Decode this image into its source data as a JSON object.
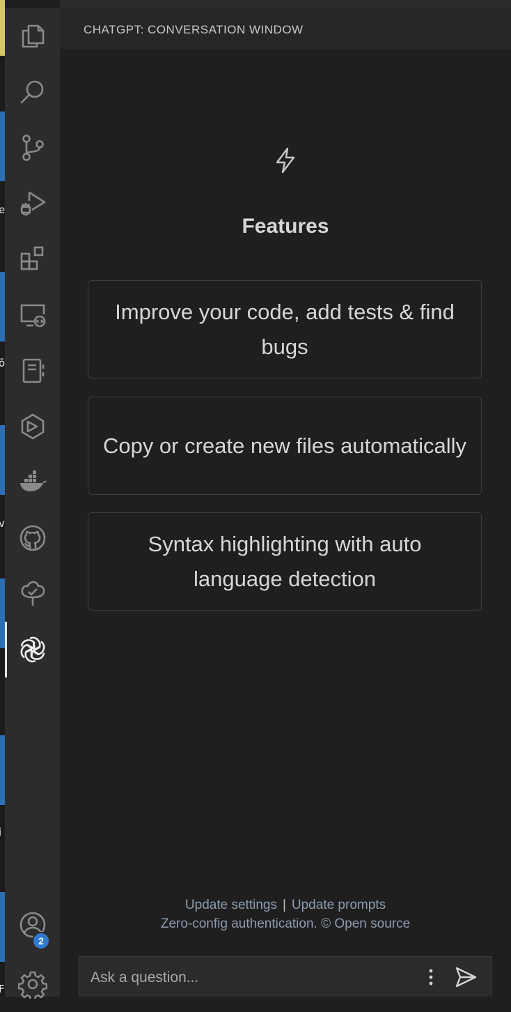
{
  "header": {
    "title": "CHATGPT: CONVERSATION WINDOW"
  },
  "activity_bar": {
    "items": [
      {
        "icon": "files-icon"
      },
      {
        "icon": "search-icon"
      },
      {
        "icon": "source-control-icon"
      },
      {
        "icon": "run-debug-icon"
      },
      {
        "icon": "extensions-icon"
      },
      {
        "icon": "remote-explorer-icon"
      },
      {
        "icon": "notebook-icon"
      },
      {
        "icon": "cube-icon"
      },
      {
        "icon": "docker-icon"
      },
      {
        "icon": "github-icon"
      },
      {
        "icon": "tree-check-icon"
      },
      {
        "icon": "openai-icon",
        "active": true
      }
    ],
    "accounts_badge": "2",
    "bottom": [
      {
        "icon": "accounts-icon"
      },
      {
        "icon": "gear-icon"
      }
    ]
  },
  "main": {
    "features_title": "Features",
    "features": [
      "Improve your code, add tests & find bugs",
      "Copy or create new files automatically",
      "Syntax highlighting with auto language detection"
    ]
  },
  "footer": {
    "update_settings": "Update settings",
    "separator": "|",
    "update_prompts": "Update prompts",
    "auth_text": "Zero-config authentication. © Open source"
  },
  "input": {
    "placeholder": "Ask a question..."
  },
  "colors": {
    "background": "#1f1f1f",
    "activity_bar": "#2c2c2c",
    "link": "#8e9cb0",
    "badge": "#2f7ad1"
  }
}
